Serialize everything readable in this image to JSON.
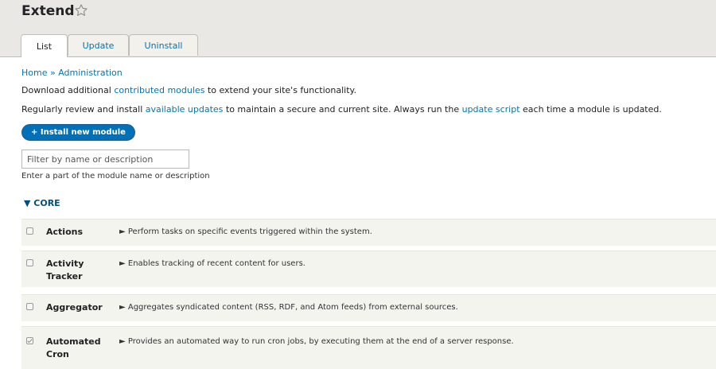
{
  "header": {
    "title": "Extend"
  },
  "tabs": [
    {
      "label": "List"
    },
    {
      "label": "Update"
    },
    {
      "label": "Uninstall"
    }
  ],
  "breadcrumb": {
    "home": "Home",
    "sep": " » ",
    "admin": "Administration"
  },
  "intro": {
    "line1_pre": "Download additional ",
    "line1_link": "contributed modules",
    "line1_post": " to extend your site's functionality.",
    "line2_pre": "Regularly review and install ",
    "line2_link1": "available updates",
    "line2_mid": " to maintain a secure and current site. Always run the ",
    "line2_link2": "update script",
    "line2_post": " each time a module is updated."
  },
  "install_button": "+ Install new module",
  "filter": {
    "placeholder": "Filter by name or description",
    "hint": "Enter a part of the module name or description"
  },
  "core_section": {
    "label": "▼ CORE"
  },
  "modules": [
    {
      "name_line1": "Actions",
      "name_line2": "",
      "checked": false,
      "description": "► Perform tasks on specific events triggered within the system."
    },
    {
      "name_line1": "Activity",
      "name_line2": "Tracker",
      "checked": false,
      "description": "► Enables tracking of recent content for users."
    },
    {
      "name_line1": "Aggregator",
      "name_line2": "",
      "checked": false,
      "description": "► Aggregates syndicated content (RSS, RDF, and Atom feeds) from external sources."
    },
    {
      "name_line1": "Automated",
      "name_line2": "Cron",
      "checked": true,
      "description": "► Provides an automated way to run cron jobs, by executing them at the end of a server response."
    }
  ]
}
